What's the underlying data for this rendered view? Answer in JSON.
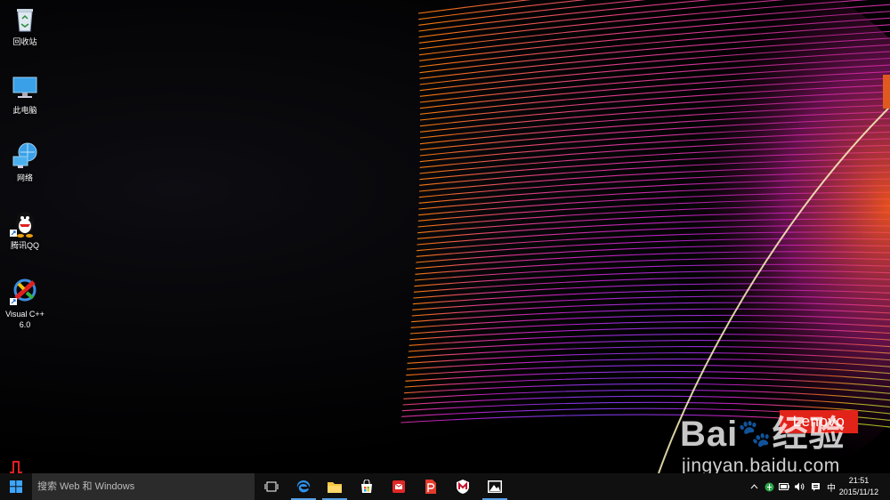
{
  "desktop": {
    "icons": [
      {
        "label": "回收站",
        "icon": "recycle-bin-icon"
      },
      {
        "label": "此电脑",
        "icon": "computer-icon"
      },
      {
        "label": "网络",
        "icon": "network-icon"
      },
      {
        "label": "腾讯QQ",
        "icon": "qq-penguin-icon"
      },
      {
        "label": "Visual C++\n6.0",
        "icon": "visual-cpp-icon"
      }
    ]
  },
  "wallpaper": {
    "brand": "Lenovo",
    "watermark_text": "Bai",
    "watermark_cn": "经验",
    "watermark_url": "jingyan.baidu.com",
    "colors": {
      "lenovo_red": "#e2231a",
      "feather_purple": "#a020c0",
      "feather_orange": "#ff7a10",
      "feather_yellow": "#e8f020"
    }
  },
  "taskbar": {
    "start_icon": "windows-logo-icon",
    "search_placeholder": "搜索 Web 和 Windows",
    "pinned": [
      {
        "name": "task-view",
        "icon": "task-view-icon"
      },
      {
        "name": "edge",
        "icon": "edge-icon"
      },
      {
        "name": "file-explorer",
        "icon": "folder-icon"
      },
      {
        "name": "store",
        "icon": "store-icon"
      },
      {
        "name": "app-red",
        "icon": "red-app-icon"
      },
      {
        "name": "wps-writer",
        "icon": "wps-icon"
      },
      {
        "name": "mcafee",
        "icon": "mcafee-shield-icon"
      },
      {
        "name": "photos",
        "icon": "photos-icon"
      }
    ],
    "tray": {
      "input_method": "中",
      "time": "21:51",
      "date": "2015/11/12"
    }
  }
}
